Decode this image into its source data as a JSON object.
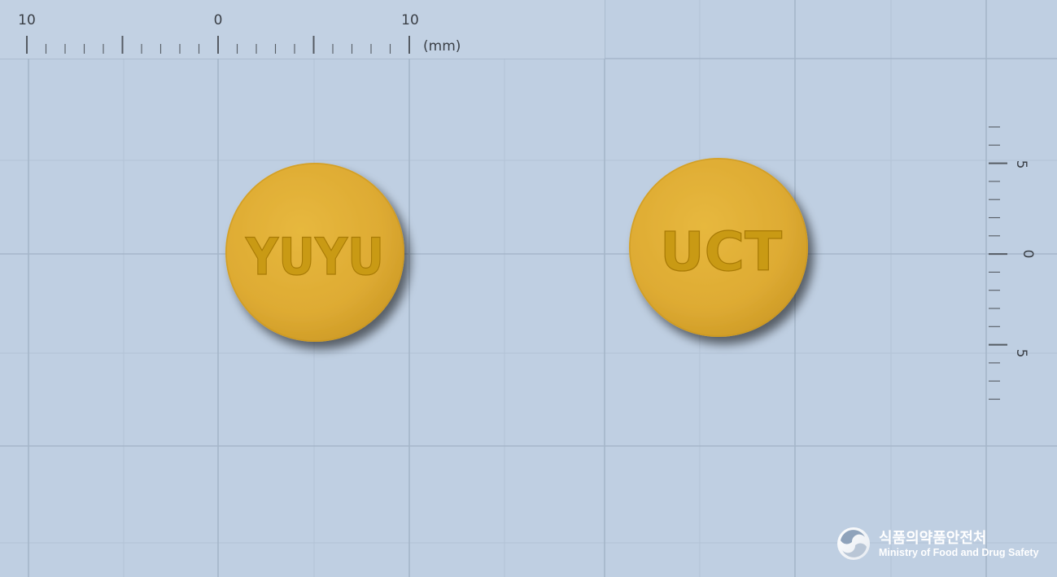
{
  "scale": {
    "horizontal": {
      "labels": [
        "10",
        "0",
        "10"
      ],
      "unit": "(mm)"
    },
    "vertical": {
      "labels": [
        "5",
        "0",
        "5"
      ]
    }
  },
  "tablets": [
    {
      "imprint": "YUYU",
      "color": "#e0ae35"
    },
    {
      "imprint": "UCT",
      "color": "#e0ae35"
    }
  ],
  "watermark": {
    "korean": "식품의약품안전처",
    "english": "Ministry of Food and Drug Safety"
  },
  "colors": {
    "background": "#bfcfe2",
    "grid_major": "#a5b6c9",
    "tablet": "#e0ae35"
  }
}
